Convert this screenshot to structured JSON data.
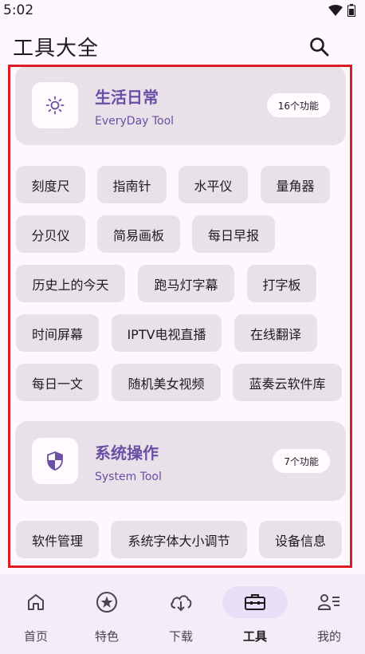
{
  "status": {
    "time": "5:02"
  },
  "header": {
    "title": "工具大全"
  },
  "sections": [
    {
      "title": "生活日常",
      "subtitle": "EveryDay Tool",
      "badge": "16个功能",
      "icon": "sun-icon",
      "tools": [
        "刻度尺",
        "指南针",
        "水平仪",
        "量角器",
        "分贝仪",
        "简易画板",
        "每日早报",
        "历史上的今天",
        "跑马灯字幕",
        "打字板",
        "时间屏幕",
        "IPTV电视直播",
        "在线翻译",
        "每日一文",
        "随机美女视频",
        "蓝奏云软件库"
      ]
    },
    {
      "title": "系统操作",
      "subtitle": "System Tool",
      "badge": "7个功能",
      "icon": "shield-icon",
      "tools": [
        "软件管理",
        "系统字体大小调节",
        "设备信息"
      ]
    }
  ],
  "bottom_nav": [
    {
      "label": "首页",
      "icon": "home-icon"
    },
    {
      "label": "特色",
      "icon": "star-icon"
    },
    {
      "label": "下载",
      "icon": "cloud-download-icon"
    },
    {
      "label": "工具",
      "icon": "toolbox-icon",
      "active": true
    },
    {
      "label": "我的",
      "icon": "person-list-icon"
    }
  ],
  "colors": {
    "accent": "#6a4fa3",
    "highlight": "#e01b24",
    "chip": "#e8e1ea"
  }
}
